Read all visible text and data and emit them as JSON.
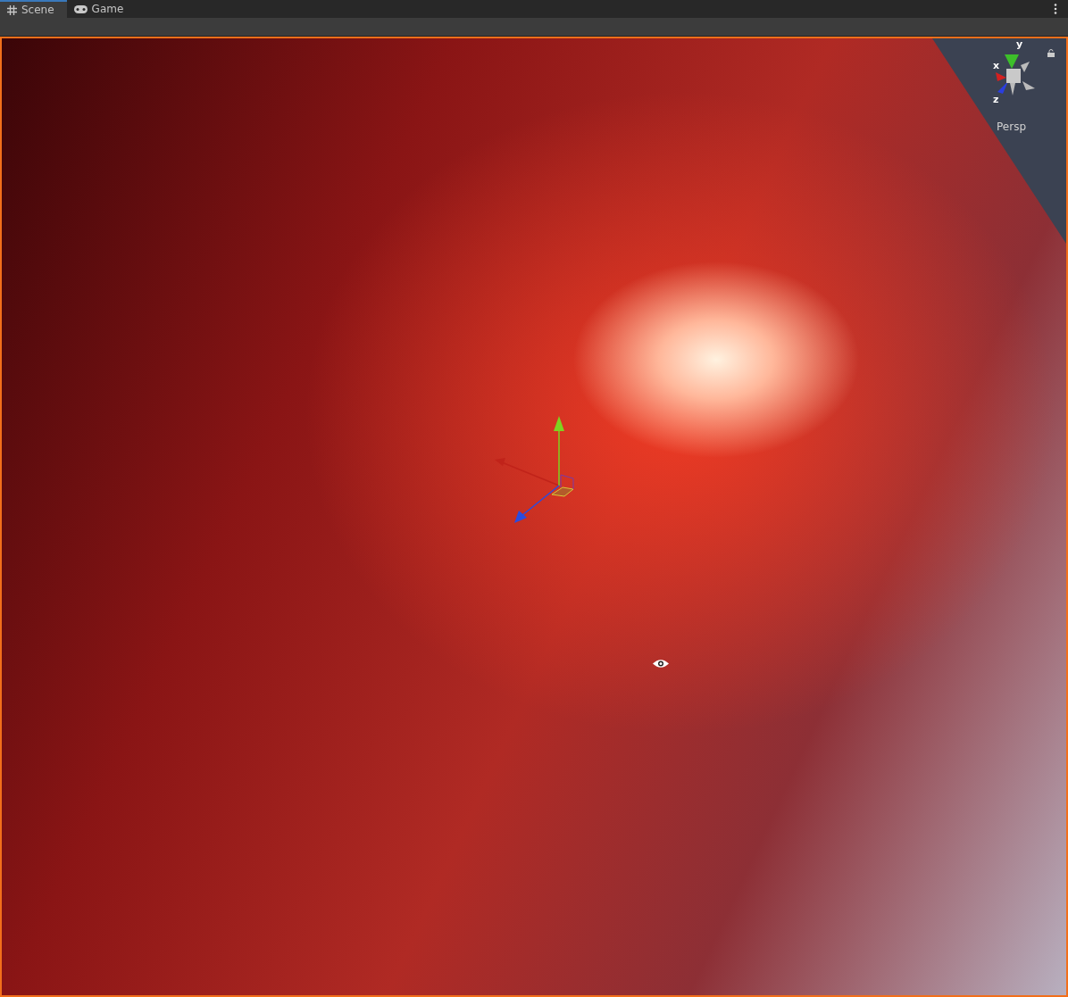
{
  "tabs": [
    {
      "kind": "scene",
      "label": "Scene",
      "selected": true
    },
    {
      "kind": "game",
      "label": "Game",
      "selected": false
    }
  ],
  "scene_gizmo": {
    "axes": [
      {
        "kind": "y",
        "label": "y"
      },
      {
        "kind": "x",
        "label": "x"
      },
      {
        "kind": "z",
        "label": "z"
      }
    ],
    "projection": "Persp"
  }
}
